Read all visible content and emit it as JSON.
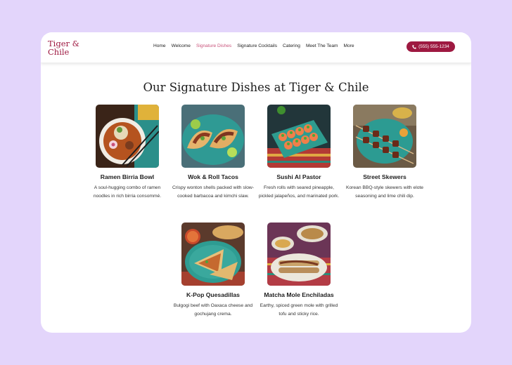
{
  "header": {
    "logo": "Tiger & Chile",
    "nav": [
      "Home",
      "Welcome",
      "Signature Dishes",
      "Signature Cocktails",
      "Catering",
      "Meet The Team",
      "More"
    ],
    "active_nav": "Signature Dishes",
    "phone": "(555) 555-1234",
    "phone_icon": "phone-icon"
  },
  "colors": {
    "background": "#e3d5fb",
    "brand": "#9e1941",
    "active_link": "#c8527a"
  },
  "page_title": "Our Signature Dishes at Tiger & Chile",
  "dishes": [
    {
      "name": "Ramen Birria Bowl",
      "desc": "A soul-hugging combo of ramen noodles in rich birria consommé."
    },
    {
      "name": "Wok & Roll Tacos",
      "desc": "Crispy wonton shells packed with slow-cooked barbacoa and kimchi slaw."
    },
    {
      "name": "Sushi Al Pastor",
      "desc": "Fresh rolls with seared pineapple, pickled jalapeños, and marinated pork."
    },
    {
      "name": "Street Skewers",
      "desc": "Korean BBQ-style skewers with elote seasoning and lime chili dip."
    },
    {
      "name": "K-Pop Quesadillas",
      "desc": "Bulgogi beef with Oaxaca cheese and gochujang crema."
    },
    {
      "name": "Matcha Mole Enchiladas",
      "desc": "Earthy, spiced green mole with grilled tofu and sticky rice."
    }
  ]
}
